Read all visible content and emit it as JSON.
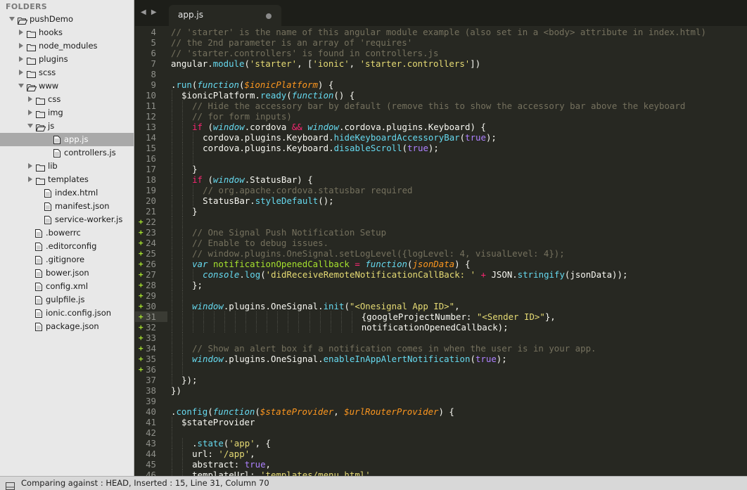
{
  "sidebar": {
    "header": "FOLDERS",
    "tree": [
      {
        "label": "pushDemo",
        "kind": "folder",
        "depth": 0,
        "expanded": true
      },
      {
        "label": "hooks",
        "kind": "folder",
        "depth": 1,
        "expanded": false
      },
      {
        "label": "node_modules",
        "kind": "folder",
        "depth": 1,
        "expanded": false
      },
      {
        "label": "plugins",
        "kind": "folder",
        "depth": 1,
        "expanded": false
      },
      {
        "label": "scss",
        "kind": "folder",
        "depth": 1,
        "expanded": false
      },
      {
        "label": "www",
        "kind": "folder",
        "depth": 1,
        "expanded": true
      },
      {
        "label": "css",
        "kind": "folder",
        "depth": 2,
        "expanded": false
      },
      {
        "label": "img",
        "kind": "folder",
        "depth": 2,
        "expanded": false
      },
      {
        "label": "js",
        "kind": "folder",
        "depth": 2,
        "expanded": true
      },
      {
        "label": "app.js",
        "kind": "file",
        "depth": 3,
        "selected": true
      },
      {
        "label": "controllers.js",
        "kind": "file",
        "depth": 3
      },
      {
        "label": "lib",
        "kind": "folder",
        "depth": 2,
        "expanded": false
      },
      {
        "label": "templates",
        "kind": "folder",
        "depth": 2,
        "expanded": false
      },
      {
        "label": "index.html",
        "kind": "file",
        "depth": 2
      },
      {
        "label": "manifest.json",
        "kind": "file",
        "depth": 2
      },
      {
        "label": "service-worker.js",
        "kind": "file",
        "depth": 2
      },
      {
        "label": ".bowerrc",
        "kind": "file",
        "depth": 1
      },
      {
        "label": ".editorconfig",
        "kind": "file",
        "depth": 1
      },
      {
        "label": ".gitignore",
        "kind": "file",
        "depth": 1
      },
      {
        "label": "bower.json",
        "kind": "file",
        "depth": 1
      },
      {
        "label": "config.xml",
        "kind": "file",
        "depth": 1
      },
      {
        "label": "gulpfile.js",
        "kind": "file",
        "depth": 1
      },
      {
        "label": "ionic.config.json",
        "kind": "file",
        "depth": 1
      },
      {
        "label": "package.json",
        "kind": "file",
        "depth": 1
      }
    ]
  },
  "tabbar": {
    "nav_arrows": "◀ ▶",
    "active_tab": "app.js"
  },
  "editor": {
    "current_line": 31,
    "lines": [
      {
        "n": "4",
        "m": "",
        "g": 0,
        "t": [
          [
            "c",
            "// 'starter' is the name of this angular module example (also set in a <body> attribute in index.html)"
          ]
        ]
      },
      {
        "n": "5",
        "m": "",
        "g": 0,
        "t": [
          [
            "c",
            "// the 2nd parameter is an array of 'requires'"
          ]
        ]
      },
      {
        "n": "6",
        "m": "",
        "g": 0,
        "t": [
          [
            "c",
            "// 'starter.controllers' is found in controllers.js"
          ]
        ]
      },
      {
        "n": "7",
        "m": "",
        "g": 0,
        "t": [
          [
            "p",
            "angular."
          ],
          [
            "f",
            "module"
          ],
          [
            "p",
            "("
          ],
          [
            "s",
            "'starter'"
          ],
          [
            "p",
            ", ["
          ],
          [
            "s",
            "'ionic'"
          ],
          [
            "p",
            ", "
          ],
          [
            "s",
            "'starter.controllers'"
          ],
          [
            "p",
            "])"
          ]
        ]
      },
      {
        "n": "8",
        "m": "",
        "g": 0,
        "t": []
      },
      {
        "n": "9",
        "m": "",
        "g": 0,
        "t": [
          [
            "p",
            "."
          ],
          [
            "f",
            "run"
          ],
          [
            "p",
            "("
          ],
          [
            "st",
            "function"
          ],
          [
            "p",
            "("
          ],
          [
            "a",
            "$ionicPlatform"
          ],
          [
            "p",
            ") {"
          ]
        ]
      },
      {
        "n": "10",
        "m": "",
        "g": 1,
        "t": [
          [
            "p",
            "$ionicPlatform."
          ],
          [
            "f",
            "ready"
          ],
          [
            "p",
            "("
          ],
          [
            "st",
            "function"
          ],
          [
            "p",
            "() {"
          ]
        ]
      },
      {
        "n": "11",
        "m": "",
        "g": 2,
        "t": [
          [
            "c",
            "// Hide the accessory bar by default (remove this to show the accessory bar above the keyboard"
          ]
        ]
      },
      {
        "n": "12",
        "m": "",
        "g": 2,
        "t": [
          [
            "c",
            "// for form inputs)"
          ]
        ]
      },
      {
        "n": "13",
        "m": "",
        "g": 2,
        "t": [
          [
            "k",
            "if"
          ],
          [
            "p",
            " ("
          ],
          [
            "st",
            "window"
          ],
          [
            "p",
            ".cordova "
          ],
          [
            "k",
            "&&"
          ],
          [
            "p",
            " "
          ],
          [
            "st",
            "window"
          ],
          [
            "p",
            ".cordova.plugins.Keyboard) {"
          ]
        ]
      },
      {
        "n": "14",
        "m": "",
        "g": 3,
        "t": [
          [
            "p",
            "cordova.plugins.Keyboard."
          ],
          [
            "f",
            "hideKeyboardAccessoryBar"
          ],
          [
            "p",
            "("
          ],
          [
            "n",
            "true"
          ],
          [
            "p",
            ");"
          ]
        ]
      },
      {
        "n": "15",
        "m": "",
        "g": 3,
        "t": [
          [
            "p",
            "cordova.plugins.Keyboard."
          ],
          [
            "f",
            "disableScroll"
          ],
          [
            "p",
            "("
          ],
          [
            "n",
            "true"
          ],
          [
            "p",
            ");"
          ]
        ]
      },
      {
        "n": "16",
        "m": "",
        "g": 3,
        "t": []
      },
      {
        "n": "17",
        "m": "",
        "g": 2,
        "t": [
          [
            "p",
            "}"
          ]
        ]
      },
      {
        "n": "18",
        "m": "",
        "g": 2,
        "t": [
          [
            "k",
            "if"
          ],
          [
            "p",
            " ("
          ],
          [
            "st",
            "window"
          ],
          [
            "p",
            ".StatusBar) {"
          ]
        ]
      },
      {
        "n": "19",
        "m": "",
        "g": 3,
        "t": [
          [
            "c",
            "// org.apache.cordova.statusbar required"
          ]
        ]
      },
      {
        "n": "20",
        "m": "",
        "g": 3,
        "t": [
          [
            "p",
            "StatusBar."
          ],
          [
            "f",
            "styleDefault"
          ],
          [
            "p",
            "();"
          ]
        ]
      },
      {
        "n": "21",
        "m": "",
        "g": 2,
        "t": [
          [
            "p",
            "}"
          ]
        ]
      },
      {
        "n": "22",
        "m": "+",
        "g": 2,
        "t": []
      },
      {
        "n": "23",
        "m": "+",
        "g": 2,
        "t": [
          [
            "c",
            "// One Signal Push Notification Setup"
          ]
        ]
      },
      {
        "n": "24",
        "m": "+",
        "g": 2,
        "t": [
          [
            "c",
            "// Enable to debug issues."
          ]
        ]
      },
      {
        "n": "25",
        "m": "+",
        "g": 2,
        "t": [
          [
            "c",
            "// window.plugins.OneSignal.setLogLevel({logLevel: 4, visualLevel: 4});"
          ]
        ]
      },
      {
        "n": "26",
        "m": "+",
        "g": 2,
        "t": [
          [
            "st",
            "var"
          ],
          [
            "p",
            " "
          ],
          [
            "cl",
            "notificationOpenedCallback"
          ],
          [
            "p",
            " "
          ],
          [
            "k",
            "="
          ],
          [
            "p",
            " "
          ],
          [
            "st",
            "function"
          ],
          [
            "p",
            "("
          ],
          [
            "a",
            "jsonData"
          ],
          [
            "p",
            ") {"
          ]
        ]
      },
      {
        "n": "27",
        "m": "+",
        "g": 3,
        "t": [
          [
            "st",
            "console"
          ],
          [
            "p",
            "."
          ],
          [
            "f",
            "log"
          ],
          [
            "p",
            "("
          ],
          [
            "s",
            "'didReceiveRemoteNotificationCallBack: '"
          ],
          [
            "p",
            " "
          ],
          [
            "k",
            "+"
          ],
          [
            "p",
            " JSON."
          ],
          [
            "f",
            "stringify"
          ],
          [
            "p",
            "(jsonData));"
          ]
        ]
      },
      {
        "n": "28",
        "m": "+",
        "g": 2,
        "t": [
          [
            "p",
            "};"
          ]
        ]
      },
      {
        "n": "29",
        "m": "+",
        "g": 2,
        "t": []
      },
      {
        "n": "30",
        "m": "+",
        "g": 2,
        "t": [
          [
            "st",
            "window"
          ],
          [
            "p",
            ".plugins.OneSignal."
          ],
          [
            "f",
            "init"
          ],
          [
            "p",
            "("
          ],
          [
            "s",
            "\"<Onesignal App ID>\""
          ],
          [
            "p",
            ","
          ]
        ]
      },
      {
        "n": "31",
        "m": "+",
        "g": 18,
        "t": [
          [
            "p",
            "{googleProjectNumber: "
          ],
          [
            "s",
            "\"<Sender ID>\""
          ],
          [
            "p",
            "},"
          ]
        ]
      },
      {
        "n": "32",
        "m": "+",
        "g": 18,
        "t": [
          [
            "p",
            "notificationOpenedCallback);"
          ]
        ]
      },
      {
        "n": "33",
        "m": "+",
        "g": 2,
        "t": []
      },
      {
        "n": "34",
        "m": "+",
        "g": 2,
        "t": [
          [
            "c",
            "// Show an alert box if a notification comes in when the user is in your app."
          ]
        ]
      },
      {
        "n": "35",
        "m": "+",
        "g": 2,
        "t": [
          [
            "st",
            "window"
          ],
          [
            "p",
            ".plugins.OneSignal."
          ],
          [
            "f",
            "enableInAppAlertNotification"
          ],
          [
            "p",
            "("
          ],
          [
            "n",
            "true"
          ],
          [
            "p",
            ");"
          ]
        ]
      },
      {
        "n": "36",
        "m": "+",
        "g": 2,
        "t": []
      },
      {
        "n": "37",
        "m": "",
        "g": 1,
        "t": [
          [
            "p",
            "});"
          ]
        ]
      },
      {
        "n": "38",
        "m": "",
        "g": 0,
        "t": [
          [
            "p",
            "})"
          ]
        ]
      },
      {
        "n": "39",
        "m": "",
        "g": 0,
        "t": []
      },
      {
        "n": "40",
        "m": "",
        "g": 0,
        "t": [
          [
            "p",
            "."
          ],
          [
            "f",
            "config"
          ],
          [
            "p",
            "("
          ],
          [
            "st",
            "function"
          ],
          [
            "p",
            "("
          ],
          [
            "a",
            "$stateProvider"
          ],
          [
            "p",
            ", "
          ],
          [
            "a",
            "$urlRouterProvider"
          ],
          [
            "p",
            ") {"
          ]
        ]
      },
      {
        "n": "41",
        "m": "",
        "g": 1,
        "t": [
          [
            "p",
            "$stateProvider"
          ]
        ]
      },
      {
        "n": "42",
        "m": "",
        "g": 1,
        "t": []
      },
      {
        "n": "43",
        "m": "",
        "g": 2,
        "t": [
          [
            "p",
            "."
          ],
          [
            "f",
            "state"
          ],
          [
            "p",
            "("
          ],
          [
            "s",
            "'app'"
          ],
          [
            "p",
            ", {"
          ]
        ]
      },
      {
        "n": "44",
        "m": "",
        "g": 2,
        "t": [
          [
            "p",
            "url: "
          ],
          [
            "s",
            "'/app'"
          ],
          [
            "p",
            ","
          ]
        ]
      },
      {
        "n": "45",
        "m": "",
        "g": 2,
        "t": [
          [
            "p",
            "abstract: "
          ],
          [
            "n",
            "true"
          ],
          [
            "p",
            ","
          ]
        ]
      },
      {
        "n": "46",
        "m": "",
        "g": 2,
        "t": [
          [
            "p",
            "templateUrl: "
          ],
          [
            "s",
            "'templates/menu.html'"
          ],
          [
            "p",
            ","
          ]
        ]
      }
    ]
  },
  "status": {
    "text": "Comparing against : HEAD, Inserted : 15, Line 31, Column 70"
  }
}
